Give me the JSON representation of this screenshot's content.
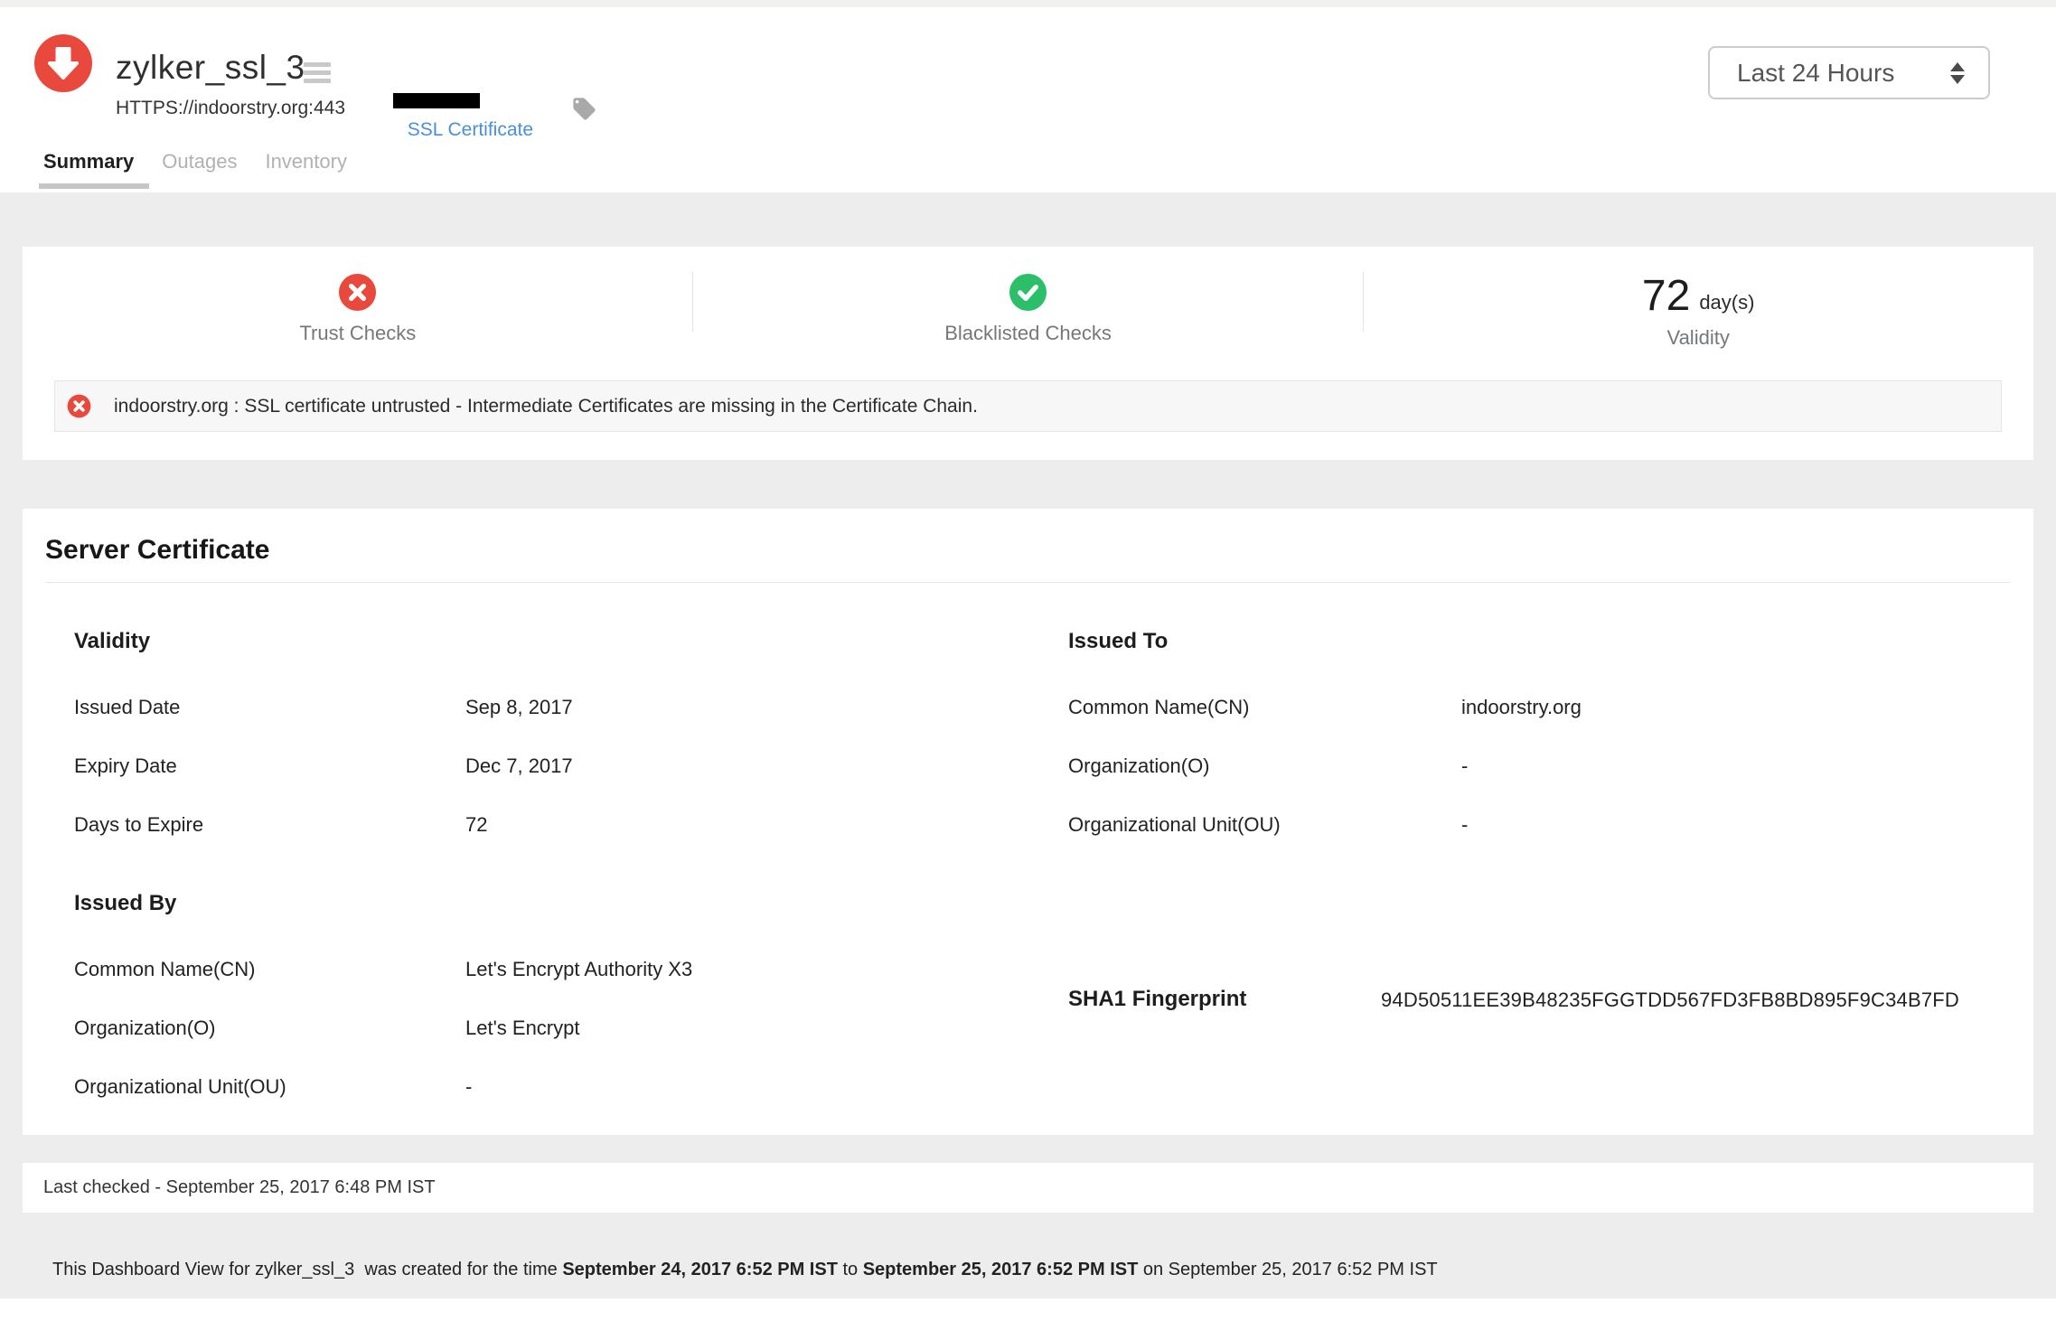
{
  "header": {
    "monitor_name": "zylker_ssl_3",
    "monitor_url": "HTTPS://indoorstry.org:443",
    "monitor_type_link": "SSL Certificate",
    "time_range_selected": "Last 24 Hours",
    "icons": {
      "monitor_status": "down-arrow-circle",
      "menu": "hamburger",
      "tag": "tag"
    }
  },
  "tabs": [
    {
      "label": "Summary"
    },
    {
      "label": "Outages"
    },
    {
      "label": "Inventory"
    }
  ],
  "status_overview": {
    "trust_checks": {
      "label": "Trust Checks",
      "status": "failed",
      "icon": "x-circle"
    },
    "blacklisted_checks": {
      "label": "Blacklisted Checks",
      "status": "passed",
      "icon": "check-circle"
    },
    "validity": {
      "value": "72",
      "unit": "day(s)",
      "label": "Validity"
    }
  },
  "alert": {
    "icon": "x-circle",
    "message": "indoorstry.org : SSL certificate untrusted - Intermediate Certificates are missing in the Certificate Chain."
  },
  "server_certificate": {
    "title": "Server Certificate",
    "validity": {
      "title": "Validity",
      "rows": [
        {
          "label": "Issued Date",
          "value": "Sep 8, 2017"
        },
        {
          "label": "Expiry Date",
          "value": "Dec 7, 2017"
        },
        {
          "label": "Days to Expire",
          "value": "72"
        }
      ]
    },
    "issued_to": {
      "title": "Issued To",
      "rows": [
        {
          "label": "Common Name(CN)",
          "value": "indoorstry.org"
        },
        {
          "label": "Organization(O)",
          "value": "-"
        },
        {
          "label": "Organizational Unit(OU)",
          "value": "-"
        }
      ]
    },
    "issued_by": {
      "title": "Issued By",
      "rows": [
        {
          "label": "Common Name(CN)",
          "value": "Let's Encrypt Authority X3"
        },
        {
          "label": "Organization(O)",
          "value": "Let's Encrypt"
        },
        {
          "label": "Organizational Unit(OU)",
          "value": "-"
        }
      ]
    },
    "sha1": {
      "label": "SHA1 Fingerprint",
      "value": "94D50511EE39B48235FGGTDD567FD3FB8BD895F9C34B7FD"
    }
  },
  "last_checked": "Last checked - September 25, 2017 6:48 PM IST",
  "footer": {
    "seg1": "This Dashboard View for zylker_ssl_3  was created for the time ",
    "bold1": "September 24, 2017 6:52 PM IST",
    "seg2": " to ",
    "bold2": "September 25, 2017 6:52 PM IST",
    "seg3": " on September 25, 2017 6:52 PM IST"
  },
  "colors": {
    "down_red": "#e8493c",
    "ok_green": "#2bbf6a",
    "link_blue": "#4a90d9"
  }
}
